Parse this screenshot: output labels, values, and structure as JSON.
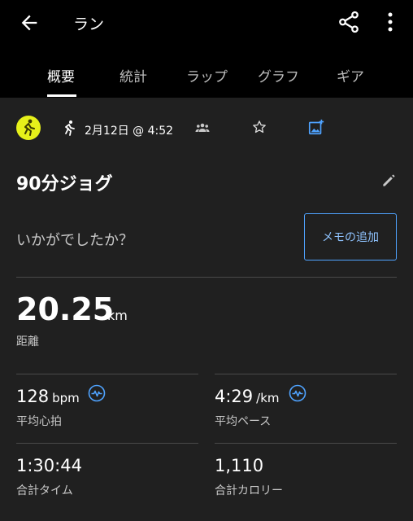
{
  "header": {
    "title": "ラン"
  },
  "tabs": [
    {
      "label": "概要"
    },
    {
      "label": "統計"
    },
    {
      "label": "ラップ"
    },
    {
      "label": "グラフ"
    },
    {
      "label": "ギア"
    }
  ],
  "activity": {
    "datetime": "2月12日 @ 4:52",
    "name": "90分ジョグ",
    "prompt": "いかがでしたか？",
    "memo_button": "メモの追加"
  },
  "distance": {
    "value": "20.25",
    "unit": "km",
    "label": "距離"
  },
  "stats": {
    "heart_rate": {
      "value": "128",
      "unit": "bpm",
      "label": "平均心拍"
    },
    "pace": {
      "value": "4:29",
      "unit": "/km",
      "label": "平均ペース"
    },
    "time": {
      "value": "1:30:44",
      "label": "合計タイム"
    },
    "calories": {
      "value": "1,110",
      "label": "合計カロリー"
    }
  },
  "colors": {
    "accent": "#4fa3ff",
    "activity_badge": "#e6f01a",
    "panel_bg": "#202020"
  },
  "icons": {
    "back": "arrow-left-icon",
    "share": "share-icon",
    "more": "more-vertical-icon",
    "activity": "runner-icon",
    "group": "group-icon",
    "favorite": "star-icon",
    "photo": "add-photo-icon",
    "edit": "pencil-icon",
    "heart_rate": "heart-rate-icon"
  }
}
